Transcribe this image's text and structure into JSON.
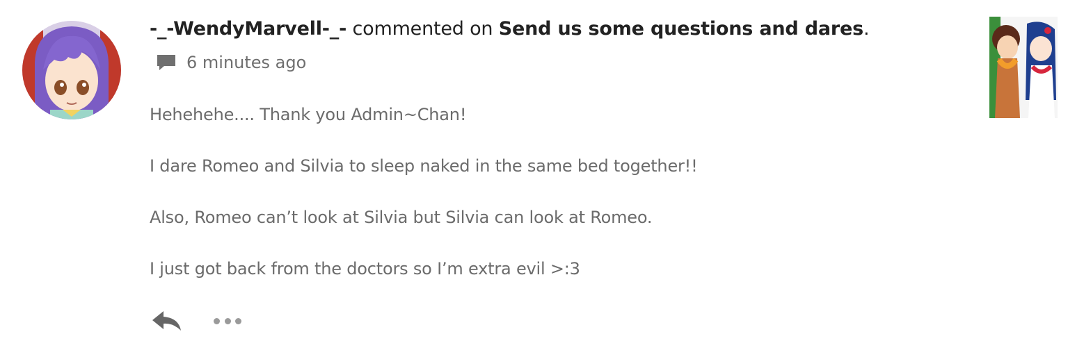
{
  "comment": {
    "username": "-_-WendyMarvell-_-",
    "action_text": " commented on ",
    "story_title": "Send us some questions and dares",
    "title_suffix": ".",
    "timestamp": "6 minutes ago",
    "timestamp_icon": "comment-bubble-icon",
    "paragraphs": [
      "Hehehehe.... Thank you Admin~Chan!",
      "I dare Romeo and Silvia to sleep naked in the same bed together!!",
      "Also, Romeo can’t look at Silvia but Silvia can look at Romeo.",
      "I just got back from the doctors so I’m extra evil >:3"
    ]
  },
  "actions": {
    "reply_icon": "reply-arrow-icon",
    "more_icon": "more-options-icon"
  },
  "colors": {
    "text_dark": "#222222",
    "text_body": "#6b6b6b",
    "icon_gray": "#6f6f6f"
  }
}
